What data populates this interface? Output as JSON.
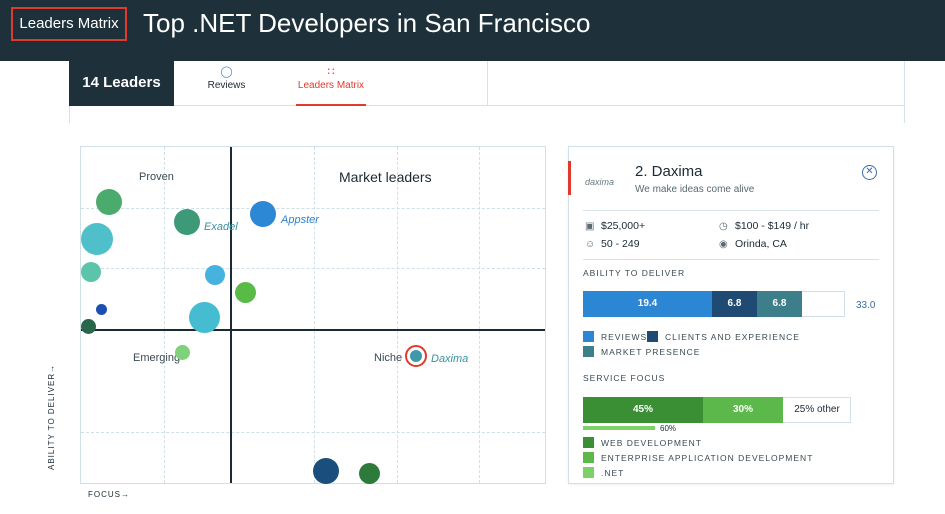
{
  "header": {
    "badge": "Leaders Matrix",
    "title": "Top .NET Developers in San Francisco"
  },
  "tabs": {
    "count_label": "14 Leaders",
    "reviews_label": "Reviews",
    "matrix_label": "Leaders Matrix"
  },
  "matrix": {
    "quadrants": {
      "proven": "Proven",
      "market_leaders": "Market leaders",
      "emerging": "Emerging",
      "niche": "Niche"
    },
    "axis_y": "ABILITY TO DELIVER→",
    "axis_x": "FOCUS→",
    "labels": {
      "exadel": "Exadel",
      "appster": "Appster",
      "daxima": "Daxima"
    },
    "colors": {
      "green": "#4aab6c",
      "teal": "#4fc0c9",
      "blue": "#2c87d4",
      "lightgreen": "#62c255",
      "darkgreen": "#2e7a3b",
      "navy": "#1b4d8a"
    }
  },
  "card": {
    "rank_name": "2. Daxima",
    "tagline": "We make ideas come alive",
    "logo_text": "daxima",
    "project_size": "$25,000+",
    "hourly_rate": "$100 - $149 / hr",
    "employees": "50 - 249",
    "location": "Orinda, CA",
    "ability_title": "ABILITY TO DELIVER",
    "ability": {
      "segments": [
        {
          "name": "REVIEWS",
          "value": "19.4",
          "color": "#2b87d4"
        },
        {
          "name": "CLIENTS AND EXPERIENCE",
          "value": "6.8",
          "color": "#1e4a73"
        },
        {
          "name": "MARKET PRESENCE",
          "value": "6.8",
          "color": "#3c7f8a"
        }
      ],
      "total": "33.0"
    },
    "focus_title": "SERVICE FOCUS",
    "focus": {
      "segments": [
        {
          "name": "WEB DEVELOPMENT",
          "value": "45%",
          "color": "#3a8e33"
        },
        {
          "name": "ENTERPRISE APPLICATION DEVELOPMENT",
          "value": "30%",
          "color": "#5cb84b"
        },
        {
          "name": ".NET",
          "value": "60%",
          "color": "#7dd168"
        }
      ],
      "other": "25% other"
    }
  }
}
